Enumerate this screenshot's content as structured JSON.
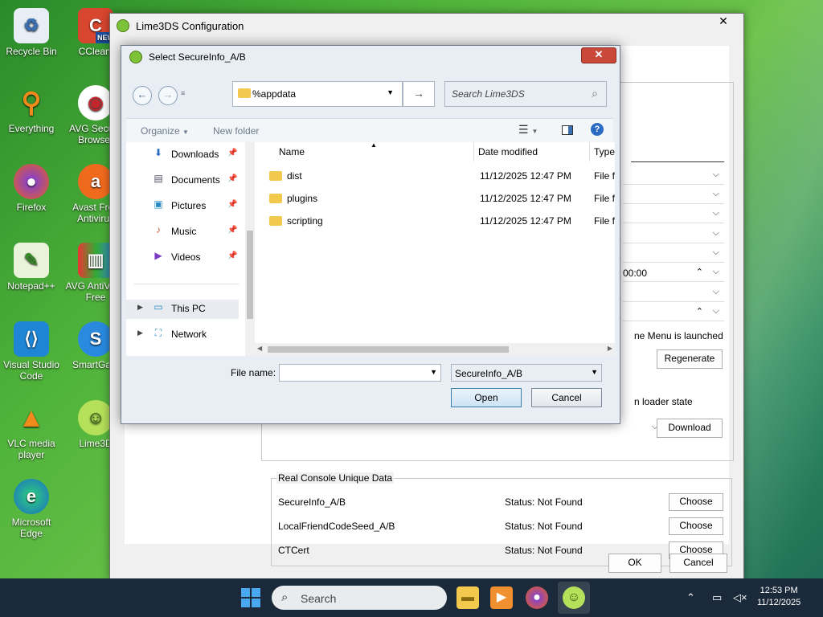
{
  "desktop": {
    "icons": [
      {
        "label": "Recycle Bin"
      },
      {
        "label": "CCleaner"
      },
      {
        "label": "Everything"
      },
      {
        "label": "AVG Secure Browser"
      },
      {
        "label": "Firefox"
      },
      {
        "label": "Avast Free Antivirus"
      },
      {
        "label": "Notepad++"
      },
      {
        "label": "AVG AntiVirus Free"
      },
      {
        "label": "Visual Studio Code"
      },
      {
        "label": "SmartGaGa"
      },
      {
        "label": "VLC media player"
      },
      {
        "label": "Lime3DS"
      },
      {
        "label": "Microsoft Edge"
      }
    ],
    "new_badge": "NEW"
  },
  "config_window": {
    "title": "Lime3DS Configuration",
    "close": "✕",
    "time_value": "00:00",
    "text_menu_launched": "ne Menu is launched",
    "regenerate": "Regenerate",
    "text_loader_state": "n loader state",
    "download": "Download",
    "group_title": "Real Console Unique Data",
    "rows": [
      {
        "name": "SecureInfo_A/B",
        "status": "Status: Not Found",
        "button": "Choose"
      },
      {
        "name": "LocalFriendCodeSeed_A/B",
        "status": "Status: Not Found",
        "button": "Choose"
      },
      {
        "name": "CTCert",
        "status": "Status: Not Found",
        "button": "Choose"
      }
    ],
    "ok": "OK",
    "cancel": "Cancel"
  },
  "dialog": {
    "title": "Select SecureInfo_A/B",
    "close": "✕",
    "address_value": "%appdata",
    "search_placeholder": "Search Lime3DS",
    "organize": "Organize",
    "new_folder": "New folder",
    "nav_items": [
      {
        "label": "Downloads",
        "icon": "⬇"
      },
      {
        "label": "Documents",
        "icon": "▤"
      },
      {
        "label": "Pictures",
        "icon": "▣"
      },
      {
        "label": "Music",
        "icon": "♪"
      },
      {
        "label": "Videos",
        "icon": "▶"
      },
      {
        "label": "This PC",
        "icon": "▭"
      },
      {
        "label": "Network",
        "icon": "⛶"
      }
    ],
    "columns": {
      "name": "Name",
      "date": "Date modified",
      "type": "Type"
    },
    "files": [
      {
        "name": "dist",
        "date": "11/12/2025 12:47 PM",
        "type": "File fo"
      },
      {
        "name": "plugins",
        "date": "11/12/2025 12:47 PM",
        "type": "File fo"
      },
      {
        "name": "scripting",
        "date": "11/12/2025 12:47 PM",
        "type": "File fo"
      }
    ],
    "file_name_label": "File name:",
    "file_name_value": "",
    "filter_value": "SecureInfo_A/B",
    "open": "Open",
    "cancel": "Cancel"
  },
  "taskbar": {
    "search_placeholder": "Search",
    "time": "12:53 PM",
    "date": "11/12/2025"
  }
}
